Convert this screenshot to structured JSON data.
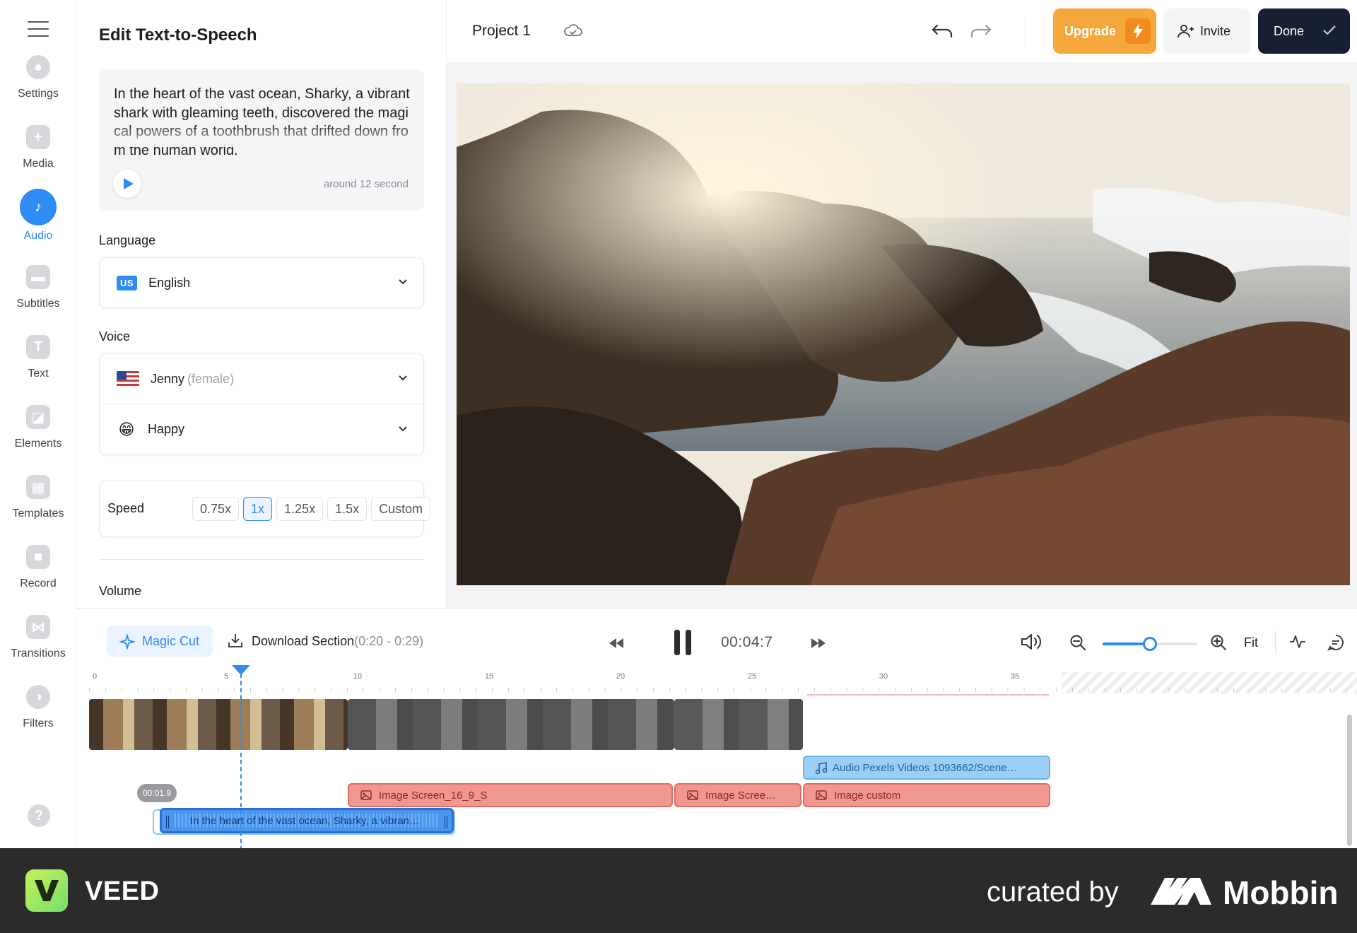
{
  "rail": {
    "items": [
      {
        "label": "Settings"
      },
      {
        "label": "Media"
      },
      {
        "label": "Audio"
      },
      {
        "label": "Subtitles"
      },
      {
        "label": "Text"
      },
      {
        "label": "Elements"
      },
      {
        "label": "Templates"
      },
      {
        "label": "Record"
      },
      {
        "label": "Transitions"
      },
      {
        "label": "Filters"
      }
    ],
    "help_label": "?"
  },
  "panel": {
    "title": "Edit Text-to-Speech",
    "tts_text": "In the heart of the vast ocean, Sharky, a vibrant shark with gleaming teeth, discovered the magical powers of a toothbrush that drifted down from the human world.",
    "duration": "around 12 second",
    "language_label": "Language",
    "language_code": "US",
    "language": "English",
    "voice_label": "Voice",
    "voice_name": "Jenny",
    "voice_meta": "(female)",
    "mood_emoji": "😁",
    "mood": "Happy",
    "speed_label": "Speed",
    "speed_options": [
      "0.75x",
      "1x",
      "1.25x",
      "1.5x",
      "Custom"
    ],
    "speed_selected": "1x",
    "volume_label": "Volume"
  },
  "topbar": {
    "project_name": "Project 1",
    "upgrade_label": "Upgrade",
    "invite_label": "Invite",
    "done_label": "Done"
  },
  "timeline": {
    "magic_cut_label": "Magic Cut",
    "download_label": "Download Section",
    "download_range": "(0:20 - 0:29)",
    "current_time": "00:04:7",
    "fit_label": "Fit",
    "zoom_level": 0.5,
    "ruler_ticks": [
      "0",
      "5",
      "10",
      "15",
      "20",
      "25",
      "30",
      "35"
    ],
    "time_bubble": "00:01.9",
    "audio_clip_label": "Audio Pexels Videos 1093662/Scene…",
    "image_clips": [
      "Image Screen_16_9_S",
      "Image Scree…",
      "Image custom"
    ],
    "tts_clip_label": "In the heart of the vast ocean, Sharky, a vibran…"
  },
  "footer": {
    "brand": "VEED",
    "logo_letter": "V",
    "curated_by": "curated by",
    "mobbin": "Mobbin"
  },
  "colors": {
    "accent": "#2f8cf2",
    "upgrade": "#f6a73b",
    "done": "#172033",
    "image_clip": "#f0978f",
    "audio_clip": "#9dcff6"
  }
}
